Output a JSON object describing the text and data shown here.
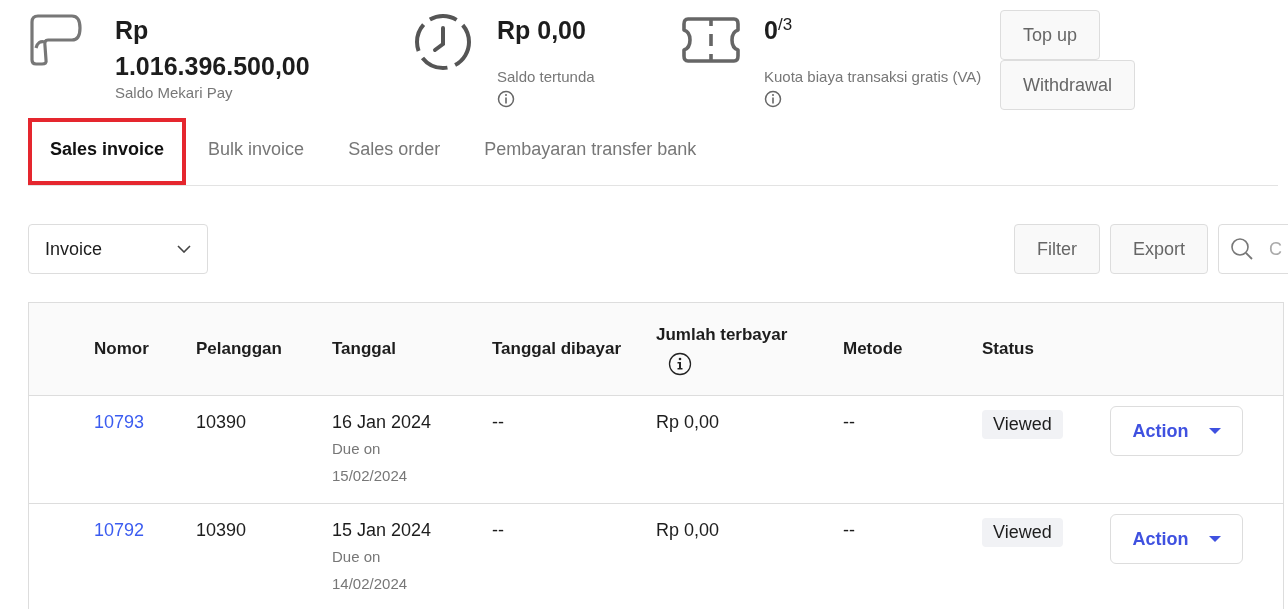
{
  "balances": [
    {
      "kind": "wallet",
      "amount": "Rp 1.016.396.500,00",
      "label": "Saldo Mekari Pay",
      "info": false
    },
    {
      "kind": "pending",
      "amount": "Rp 0,00",
      "label": "Saldo tertunda",
      "info": true
    },
    {
      "kind": "quota",
      "amount": "0",
      "total": "/3",
      "label": "Kuota biaya transaksi gratis (VA)",
      "info": true
    }
  ],
  "actions": [
    "Top up",
    "Withdrawal"
  ],
  "tabs": [
    {
      "label": "Sales invoice",
      "selected": true,
      "highlighted": true
    },
    {
      "label": "Bulk invoice",
      "selected": false,
      "highlighted": false
    },
    {
      "label": "Sales order",
      "selected": false,
      "highlighted": false
    },
    {
      "label": "Pembayaran transfer bank",
      "selected": false,
      "highlighted": false
    }
  ],
  "type_select": {
    "value": "Invoice"
  },
  "toolbar": [
    "Filter",
    "Export"
  ],
  "search": {
    "placeholder": "C"
  },
  "table": {
    "columns": [
      {
        "label": "Nomor",
        "info": false
      },
      {
        "label": "Pelanggan",
        "info": false
      },
      {
        "label": "Tanggal",
        "info": false
      },
      {
        "label": "Tanggal dibayar",
        "info": false
      },
      {
        "label": "Jumlah terbayar",
        "info": true
      },
      {
        "label": "Metode",
        "info": false
      },
      {
        "label": "Status",
        "info": false
      }
    ],
    "rows": [
      {
        "number": "10793",
        "customer": "10390",
        "date": "16 Jan 2024",
        "due_label": "Due on",
        "due": "15/02/2024",
        "paid_date": "--",
        "paid": "Rp 0,00",
        "method": "--",
        "status": "Viewed",
        "action": "Action"
      },
      {
        "number": "10792",
        "customer": "10390",
        "date": "15 Jan 2024",
        "due_label": "Due on",
        "due": "14/02/2024",
        "paid_date": "--",
        "paid": "Rp 0,00",
        "method": "--",
        "status": "Viewed",
        "action": "Action"
      }
    ]
  }
}
